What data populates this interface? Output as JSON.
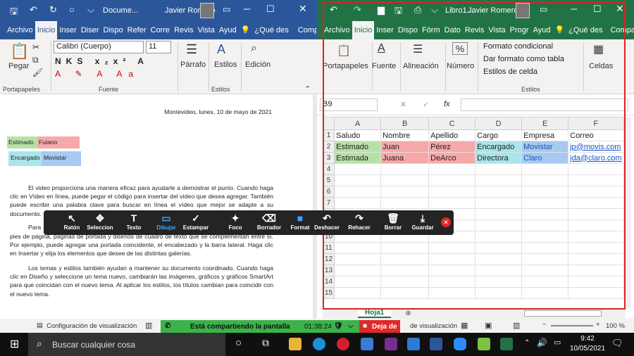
{
  "word": {
    "title": "Docume...",
    "user": "Javier Romero",
    "tabs": [
      "Archivo",
      "Inicio",
      "Inser",
      "Diser",
      "Dispo",
      "Refer",
      "Corre",
      "Revis",
      "Vista",
      "Ayud"
    ],
    "search": "¿Qué des",
    "share": "Compartir",
    "font_name": "Calibri (Cuerpo)",
    "font_size": "11",
    "paste": "Pegar",
    "paragraph": "Párrafo",
    "styles": "Estilos",
    "editing": "Edición",
    "group_clipboard": "Portapapeles",
    "group_font": "Fuente",
    "group_styles": "Estilos",
    "date_line": "Montevideo, lunes, 10 de mayo de 2021",
    "field1a": "Estimado",
    "field1b": "Fulano",
    "field2a": "Encargado",
    "field2b": "Movistar",
    "p1": "El video proporciona una manera eficaz para ayudarle a demostrar el punto. Cuando haga clic en Vídeo en línea, puede pegar el código para insertar del vídeo que desea agregar. También puede escribir una palabra clave para buscar en línea el vídeo que mejor se adapte a su documento.",
    "p2a": "Para",
    "p2b": "pies de página, páginas de portada y diseños de cuadro de texto que se complementan entre sí. Por ejemplo, puede agregar una portada coincidente, el encabezado y la barra lateral. Haga clic en Insertar y elija los elementos que desee de las distintas galerías.",
    "p3": "Los temas y estilos también ayudan a mantener su documento coordinado. Cuando haga clic en Diseño y seleccione un tema nuevo, cambiarán las imágenes, gráficos y gráficos SmartArt para que coincidan con el nuevo tema. Al aplicar los estilos, los títulos cambian para coincidir con el nuevo tema.",
    "status": "Configuración de visualización"
  },
  "excel": {
    "title": "Libro1...",
    "user": "Javier Romero",
    "tabs": [
      "Archivo",
      "Inicio",
      "Inser",
      "Dispo",
      "Fórm",
      "Dato",
      "Revis",
      "Vista",
      "Progr",
      "Ayud"
    ],
    "search": "¿Qué des",
    "share": "Compartir",
    "paste": "Portapapeles",
    "font": "Fuente",
    "align": "Alineación",
    "number": "Número",
    "cond": "Formato condicional",
    "table": "Dar formato como tabla",
    "cellstyles": "Estilos de celda",
    "cells": "Celdas",
    "group_styles": "Estilos",
    "namebox": "B9",
    "fx": "fx",
    "cols": [
      "A",
      "B",
      "C",
      "D",
      "E",
      "F"
    ],
    "rows": [
      [
        "Saludo",
        "Nombre",
        "Apellido",
        "Cargo",
        "Empresa",
        "Correo"
      ],
      [
        "Estimado",
        "Juan",
        "Pérez",
        "Encargado",
        "Movistar",
        "jp@movis.com"
      ],
      [
        "Estimada",
        "Juana",
        "DeArco",
        "Directora",
        "Claro",
        "jda@claro.com"
      ]
    ],
    "sheet": "Hoja1",
    "status": "de visualización",
    "zoom": "100 %"
  },
  "zoom_toolbar": {
    "items": [
      {
        "label": "Ratón",
        "icon": "↖"
      },
      {
        "label": "Seleccion",
        "icon": "✥"
      },
      {
        "label": "Texto",
        "icon": "T"
      },
      {
        "label": "Dibujar",
        "icon": "▭"
      },
      {
        "label": "Estampar",
        "icon": "✓"
      },
      {
        "label": "Foco",
        "icon": "✦"
      },
      {
        "label": "Borrador",
        "icon": "⌫"
      },
      {
        "label": "Format",
        "icon": "■"
      },
      {
        "label": "Deshacer",
        "icon": "↶"
      },
      {
        "label": "Rehacer",
        "icon": "↷"
      },
      {
        "label": "Borrar",
        "icon": "🗑"
      },
      {
        "label": "Guardar",
        "icon": "⤓"
      }
    ]
  },
  "sharing": {
    "label": "Está compartiendo la pantalla",
    "time": "01:38:24",
    "stop": "Deja de"
  },
  "taskbar": {
    "search": "Buscar cualquier cosa",
    "time": "9:42",
    "date": "10/05/2021"
  },
  "colors": {
    "word": "#2b579a",
    "excel": "#217346",
    "selection": "#e02020"
  }
}
